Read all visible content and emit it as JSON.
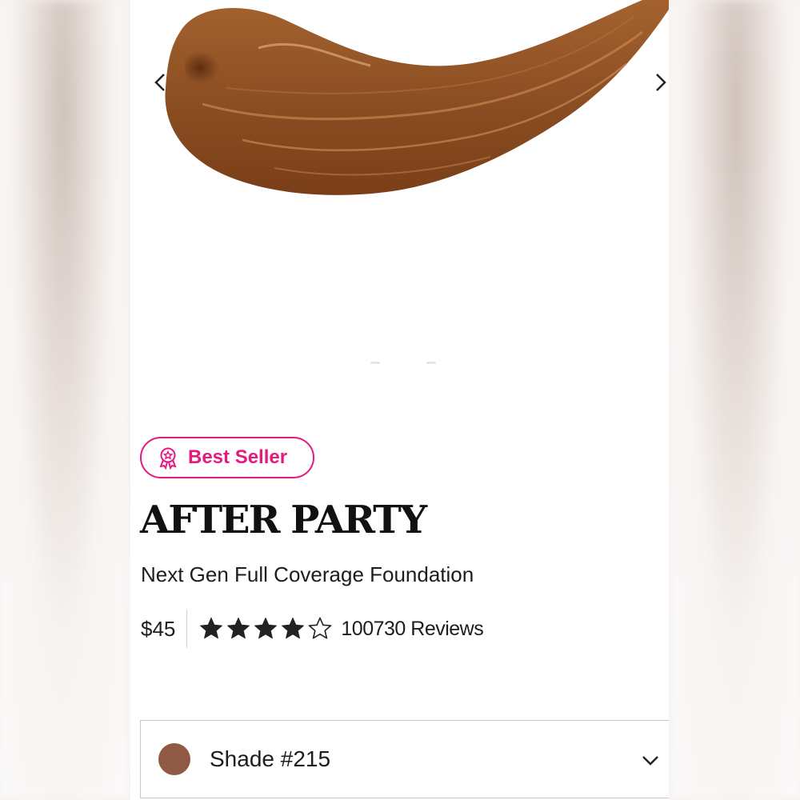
{
  "badge": {
    "label": "Best Seller",
    "color": "#e6197f",
    "icon": "award-ribbon-icon"
  },
  "product": {
    "name": "AFTER PARTY",
    "subtitle": "Next Gen Full Coverage Foundation",
    "price": "$45",
    "rating": 4,
    "rating_max": 5,
    "reviews_label": "100730 Reviews"
  },
  "gallery": {
    "prev_icon": "chevron-left-icon",
    "next_icon": "chevron-right-icon",
    "swatch_color": "#8a4d22"
  },
  "shade": {
    "label": "Shade  #215",
    "swatch_color": "#8f5a43",
    "icon": "chevron-down-icon"
  }
}
